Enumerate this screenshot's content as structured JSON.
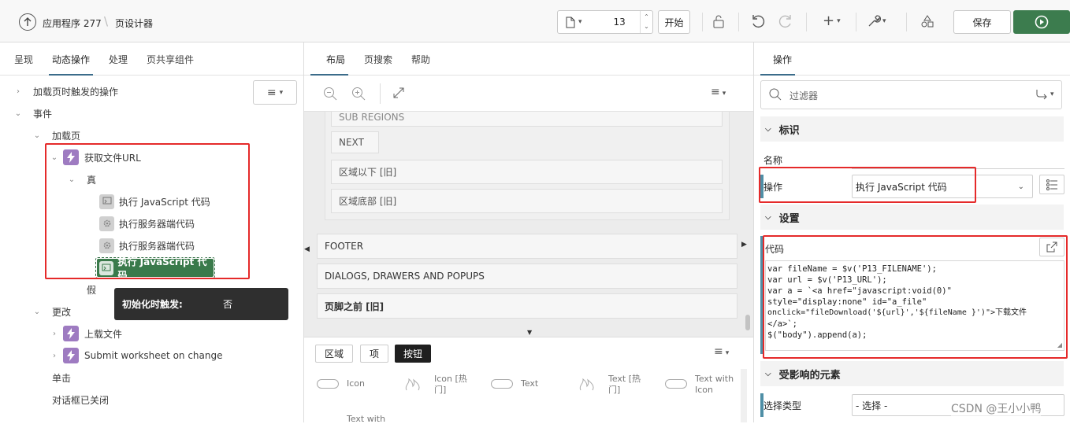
{
  "header": {
    "app_label": "应用程序 277",
    "page_designer": "页设计器",
    "page_number": "13",
    "start_label": "开始",
    "save_label": "保存"
  },
  "left": {
    "tabs": [
      "呈现",
      "动态操作",
      "处理",
      "页共享组件"
    ],
    "tree": {
      "on_load_trigger": "加载页时触发的操作",
      "events": "事件",
      "page_load": "加载页",
      "get_file_url": "获取文件URL",
      "true": "真",
      "action1": "执行 JavaScript 代码",
      "action2": "执行服务器端代码",
      "action3": "执行服务器端代码",
      "action4": "执行 JavaScript 代码",
      "false": "假",
      "change": "更改",
      "upload_file": "上载文件",
      "submit_ws": "Submit worksheet on change",
      "click": "单击",
      "dialog_closed": "对话框已关闭"
    },
    "tooltip": {
      "label": "初始化时触发:",
      "value": "否"
    }
  },
  "middle": {
    "tabs": [
      "布局",
      "页搜索",
      "帮助"
    ],
    "regions": {
      "sub_regions": "SUB REGIONS",
      "next": "NEXT",
      "below_region": "区域以下 [旧]",
      "region_bottom": "区域底部 [旧]",
      "footer": "FOOTER",
      "dialogs": "DIALOGS, DRAWERS AND POPUPS",
      "before_footer": "页脚之前 [旧]"
    },
    "gallery_tabs": [
      "区域",
      "项",
      "按钮"
    ],
    "gallery_items": [
      "Icon",
      "Icon [热门]",
      "Text",
      "Text [热门]",
      "Text with Icon",
      "Text with"
    ]
  },
  "right": {
    "tab": "操作",
    "filter_placeholder": "过滤器",
    "identification": "标识",
    "name_label": "名称",
    "name_value": "",
    "action_label": "操作",
    "action_value": "执行 JavaScript 代码",
    "settings": "设置",
    "code_label": "代码",
    "code_lines": [
      "var fileName = $v('P13_FILENAME');",
      "var url = $v('P13_URL');",
      "var a = `<a href=\"javascript:void(0)\"",
      "style=\"display:none\" id=\"a_file\"",
      "onclick=\"fileDownload('${url}','${fileName }')\">下载文件",
      "</a>`;",
      "$(\"body\").append(a);"
    ],
    "affected": "受影响的元素",
    "select_type_label": "选择类型",
    "select_type_value": "- 选择 -"
  },
  "watermark": "CSDN @王小小鸭"
}
